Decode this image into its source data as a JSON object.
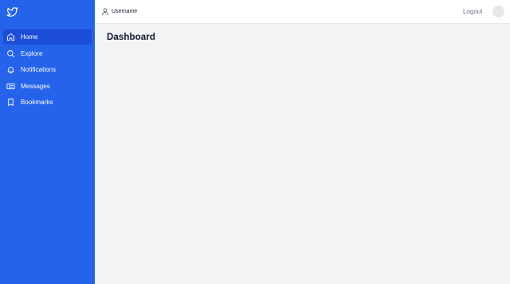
{
  "sidebar": {
    "logo_icon": "twitter-bird-icon",
    "items": [
      {
        "label": "Home",
        "icon": "home-icon",
        "active": true
      },
      {
        "label": "Explore",
        "icon": "search-icon",
        "active": false
      },
      {
        "label": "Notifications",
        "icon": "bell-icon",
        "active": false
      },
      {
        "label": "Messages",
        "icon": "inbox-icon",
        "active": false
      },
      {
        "label": "Bookmarks",
        "icon": "bookmark-icon",
        "active": false
      }
    ]
  },
  "header": {
    "username": "Username",
    "user_icon": "user-icon",
    "logout_label": "Logout"
  },
  "main": {
    "title": "Dashboard"
  },
  "colors": {
    "sidebar_bg": "#2563eb",
    "active_item_bg": "#1d4ed8",
    "page_bg": "#f2f3f5",
    "header_bg": "#ffffff"
  }
}
